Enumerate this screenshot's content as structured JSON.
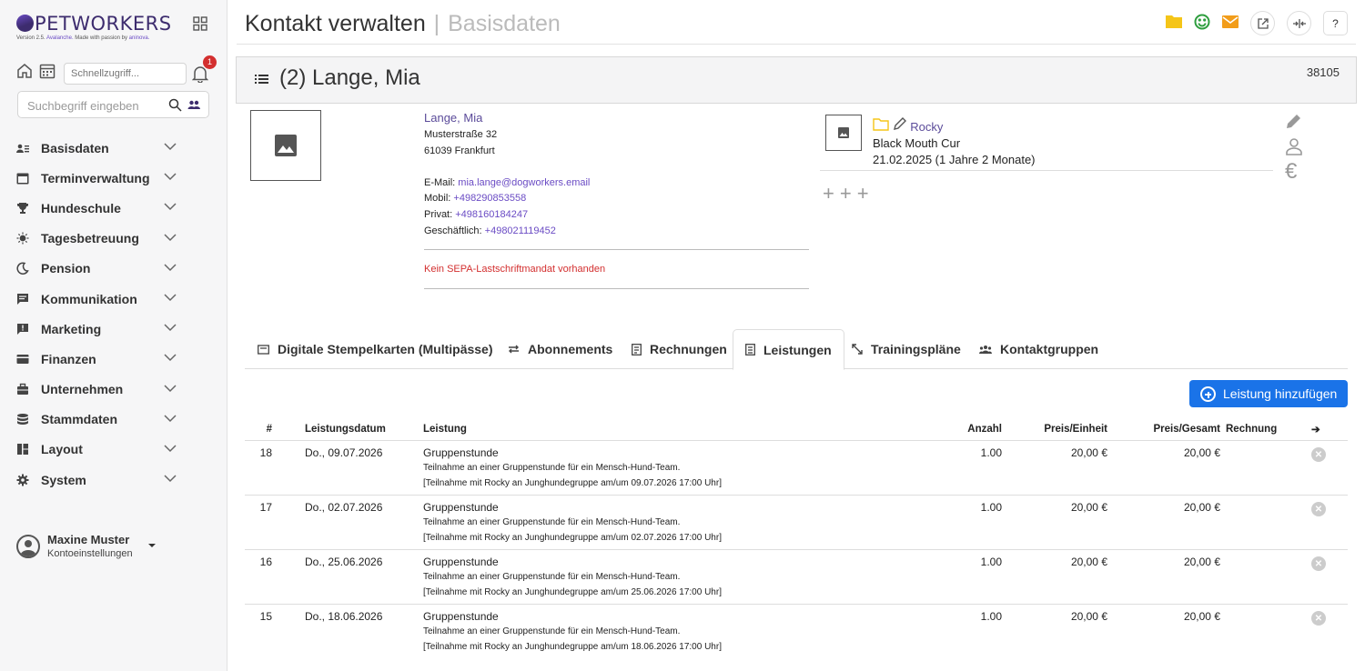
{
  "brand": {
    "name": "PETWORKERS",
    "version_prefix": "Version 2.5.",
    "version_name": "Avalanche.",
    "tagline": "Made with passion by",
    "company": "aninova."
  },
  "sidebar": {
    "quick_placeholder": "Schnellzugriff...",
    "notifications": "1",
    "search_placeholder": "Suchbegriff eingeben",
    "items": [
      {
        "label": "Basisdaten",
        "icon": "contacts-icon"
      },
      {
        "label": "Terminverwaltung",
        "icon": "calendar-icon"
      },
      {
        "label": "Hundeschule",
        "icon": "trophy-icon"
      },
      {
        "label": "Tagesbetreuung",
        "icon": "sun-icon"
      },
      {
        "label": "Pension",
        "icon": "moon-icon"
      },
      {
        "label": "Kommunikation",
        "icon": "chat-icon"
      },
      {
        "label": "Marketing",
        "icon": "megaphone-icon"
      },
      {
        "label": "Finanzen",
        "icon": "credit-card-icon"
      },
      {
        "label": "Unternehmen",
        "icon": "company-icon"
      },
      {
        "label": "Stammdaten",
        "icon": "database-icon"
      },
      {
        "label": "Layout",
        "icon": "layout-icon"
      },
      {
        "label": "System",
        "icon": "gear-icon"
      }
    ],
    "user": {
      "name": "Maxine Muster",
      "sub": "Kontoeinstellungen"
    }
  },
  "header": {
    "title": "Kontakt verwalten",
    "separator": "|",
    "subtitle": "Basisdaten",
    "help": "?",
    "colors": {
      "folder": "#f5c518",
      "smile": "#2e9e3e",
      "mail": "#f29d1a"
    }
  },
  "contact": {
    "display_name": "(2) Lange, Mia",
    "number": "38105",
    "name": "Lange, Mia",
    "street": "Musterstraße 32",
    "city": "61039 Frankfurt",
    "email_label": "E-Mail:",
    "email": "mia.lange@dogworkers.email",
    "mobile_label": "Mobil:",
    "mobile": "+498290853558",
    "private_label": "Privat:",
    "private": "+498160184247",
    "business_label": "Geschäftlich:",
    "business": "+498021119452",
    "sepa_notice": "Kein SEPA-Lastschriftmandat vorhanden"
  },
  "dog": {
    "name": "Rocky",
    "breed": "Black Mouth Cur",
    "birth": "21.02.2025 (1 Jahre 2 Monate)"
  },
  "tabs": [
    {
      "label": "Digitale Stempelkarten (Multipässe)",
      "icon": "ticket-icon"
    },
    {
      "label": "Abonnements",
      "icon": "repeat-icon"
    },
    {
      "label": "Rechnungen",
      "icon": "receipt-icon"
    },
    {
      "label": "Leistungen",
      "icon": "list-icon",
      "active": true
    },
    {
      "label": "Trainingspläne",
      "icon": "expand-icon"
    },
    {
      "label": "Kontaktgruppen",
      "icon": "group-icon"
    }
  ],
  "add_button": "Leistung hinzufügen",
  "table": {
    "headers": {
      "num": "#",
      "date": "Leistungsdatum",
      "service": "Leistung",
      "qty": "Anzahl",
      "unit": "Preis/Einheit",
      "total": "Preis/Gesamt",
      "invoice": "Rechnung",
      "arrow": "➔"
    },
    "rows": [
      {
        "num": "18",
        "date": "Do., 09.07.2026",
        "service": "Gruppenstunde",
        "desc1": "Teilnahme an einer Gruppenstunde für ein Mensch-Hund-Team.",
        "desc2": "[Teilnahme mit Rocky an Junghundegruppe am/um 09.07.2026 17:00 Uhr]",
        "qty": "1.00",
        "unit": "20,00 €",
        "total": "20,00 €"
      },
      {
        "num": "17",
        "date": "Do., 02.07.2026",
        "service": "Gruppenstunde",
        "desc1": "Teilnahme an einer Gruppenstunde für ein Mensch-Hund-Team.",
        "desc2": "[Teilnahme mit Rocky an Junghundegruppe am/um 02.07.2026 17:00 Uhr]",
        "qty": "1.00",
        "unit": "20,00 €",
        "total": "20,00 €"
      },
      {
        "num": "16",
        "date": "Do., 25.06.2026",
        "service": "Gruppenstunde",
        "desc1": "Teilnahme an einer Gruppenstunde für ein Mensch-Hund-Team.",
        "desc2": "[Teilnahme mit Rocky an Junghundegruppe am/um 25.06.2026 17:00 Uhr]",
        "qty": "1.00",
        "unit": "20,00 €",
        "total": "20,00 €"
      },
      {
        "num": "15",
        "date": "Do., 18.06.2026",
        "service": "Gruppenstunde",
        "desc1": "Teilnahme an einer Gruppenstunde für ein Mensch-Hund-Team.",
        "desc2": "[Teilnahme mit Rocky an Junghundegruppe am/um 18.06.2026 17:00 Uhr]",
        "qty": "1.00",
        "unit": "20,00 €",
        "total": "20,00 €"
      }
    ]
  }
}
